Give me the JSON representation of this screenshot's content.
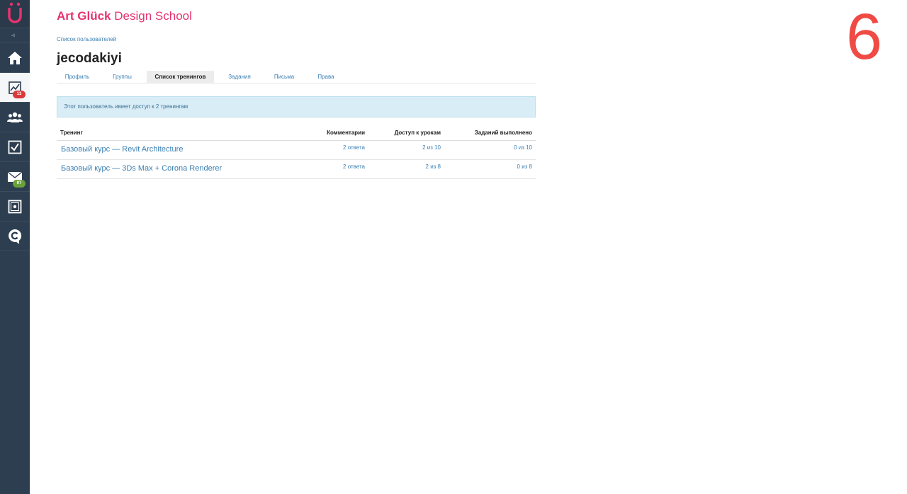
{
  "brand": {
    "bold": "Art Glück",
    "rest": " Design School",
    "color": "#e53370"
  },
  "big_number": "6",
  "breadcrumb": "Список пользователей",
  "page_title": "jecodakiyi",
  "tabs": [
    {
      "label": "Профиль",
      "active": false
    },
    {
      "label": "Группы",
      "active": false
    },
    {
      "label": "Список тренингов",
      "active": true
    },
    {
      "label": "Задания",
      "active": false
    },
    {
      "label": "Письма",
      "active": false
    },
    {
      "label": "Права",
      "active": false
    }
  ],
  "alert": "Этот пользователь имеет доступ к 2 тренингам",
  "table": {
    "headers": {
      "training": "Тренинг",
      "comments": "Комментарии",
      "access": "Доступ к урокам",
      "tasks": "Заданий выполнено"
    },
    "rows": [
      {
        "training": "Базовый курс — Revit Architecture",
        "comments": "2 ответа",
        "access": "2 из 10",
        "tasks": "0 из 10"
      },
      {
        "training": "Базовый курс — 3Ds Max + Corona Renderer",
        "comments": "2 ответа",
        "access": "2 из 8",
        "tasks": "0 из 8"
      }
    ]
  },
  "sidebar": {
    "logo_icon": "u-umlaut-logo",
    "items": [
      {
        "icon": "home-icon",
        "badge": null
      },
      {
        "icon": "chart-icon",
        "badge": "13",
        "active": true
      },
      {
        "icon": "users-icon",
        "badge": null
      },
      {
        "icon": "checkbox-icon",
        "badge": null
      },
      {
        "icon": "mail-icon",
        "badge": "97"
      },
      {
        "icon": "safe-icon",
        "badge": null
      },
      {
        "icon": "chat-c-icon",
        "badge": null
      }
    ]
  }
}
